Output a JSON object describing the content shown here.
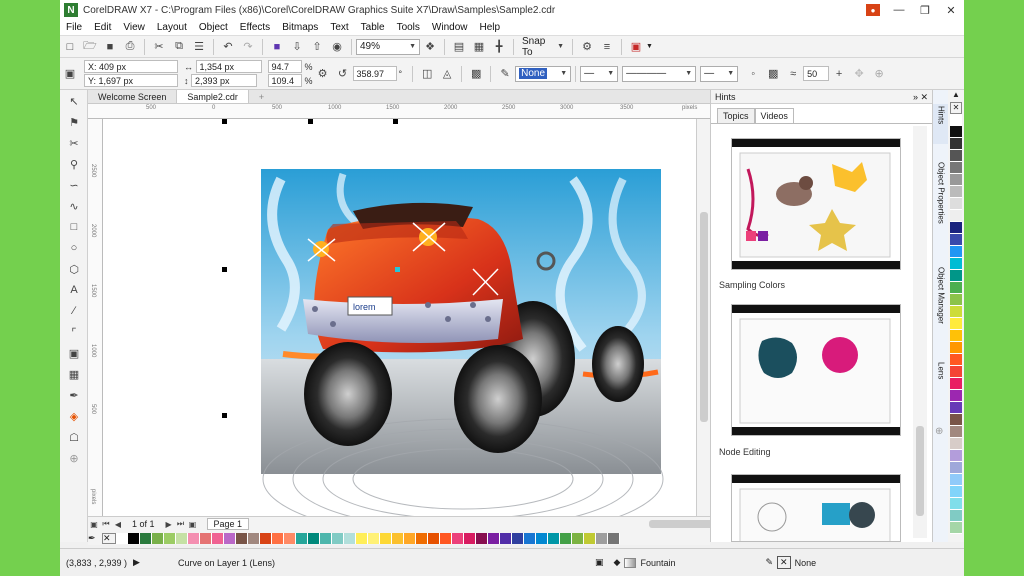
{
  "window": {
    "title": "CorelDRAW X7 - C:\\Program Files (x86)\\Corel\\CorelDRAW Graphics Suite X7\\Draw\\Samples\\Sample2.cdr",
    "logo_letter": "N"
  },
  "menu": [
    "File",
    "Edit",
    "View",
    "Layout",
    "Object",
    "Effects",
    "Bitmaps",
    "Text",
    "Table",
    "Tools",
    "Window",
    "Help"
  ],
  "standard_toolbar": {
    "zoom": "49%",
    "snap_to": "Snap To"
  },
  "property_bar": {
    "x": "X: 409 px",
    "y": "Y: 1,697 px",
    "width": "1,354 px",
    "height": "2,393 px",
    "scale_x": "94.7",
    "scale_y": "109.4",
    "percent": "%",
    "rotation": "358.97",
    "degree": "°",
    "fill_name": "None",
    "nudge": "50"
  },
  "document_tabs": [
    "Welcome Screen",
    "Sample2.cdr"
  ],
  "ruler": {
    "h_ticks": [
      "500",
      "0",
      "500",
      "1000",
      "1500",
      "2000",
      "2500",
      "3000",
      "3500"
    ],
    "h_unit": "pixels",
    "v_ticks": [
      "2500",
      "2000",
      "1500",
      "1000",
      "500"
    ],
    "v_unit": "pixels"
  },
  "page_nav": {
    "page_count": "1 of 1",
    "page_tab": "Page 1"
  },
  "plate_text": "lorem",
  "status": {
    "coordinates": "(3,833 , 2,939 )",
    "object_info": "Curve on Layer 1  (Lens)",
    "fill": "Fountain",
    "outline": "None"
  },
  "hints_docker": {
    "title": "Hints",
    "tabs": [
      "Topics",
      "Videos"
    ],
    "videos": [
      "Sampling Colors",
      "Node Editing"
    ]
  },
  "side_tabs": [
    "Hints",
    "Object Properties",
    "Object Manager",
    "Lens"
  ],
  "colors": {
    "palette": [
      "#ffffff",
      "#000000",
      "#2a7a3d",
      "#79b04a",
      "#9ccc65",
      "#c5e1a5",
      "#f48fb1",
      "#e57373",
      "#f06292",
      "#ba68c8",
      "#795548",
      "#a1887f",
      "#d84315",
      "#ff7043",
      "#ff8a65",
      "#26a69a",
      "#00897b",
      "#4db6ac",
      "#80cbc4",
      "#b2dfdb",
      "#ffee58",
      "#fff176",
      "#fdd835",
      "#fbc02d",
      "#ffa726",
      "#ef6c00",
      "#e65100",
      "#ff5722",
      "#ec407a",
      "#d81b60",
      "#880e4f",
      "#7b1fa2",
      "#512da8",
      "#303f9f",
      "#1976d2",
      "#0288d1",
      "#0097a7",
      "#43a047",
      "#7cb342",
      "#c0ca33",
      "#9e9e9e",
      "#757575"
    ],
    "v_palette": [
      "#ffffff",
      "#111111",
      "#333333",
      "#555555",
      "#777777",
      "#999999",
      "#bbbbbb",
      "#dddddd",
      "#eeeeee",
      "#1a237e",
      "#3949ab",
      "#2196f3",
      "#00bcd4",
      "#009688",
      "#4caf50",
      "#8bc34a",
      "#cddc39",
      "#ffeb3b",
      "#ffc107",
      "#ff9800",
      "#ff5722",
      "#f44336",
      "#e91e63",
      "#9c27b0",
      "#673ab7",
      "#795548",
      "#a1887f",
      "#d7ccc8",
      "#b39ddb",
      "#9fa8da",
      "#90caf9",
      "#81d4fa",
      "#80deea",
      "#80cbc4",
      "#a5d6a7"
    ]
  }
}
